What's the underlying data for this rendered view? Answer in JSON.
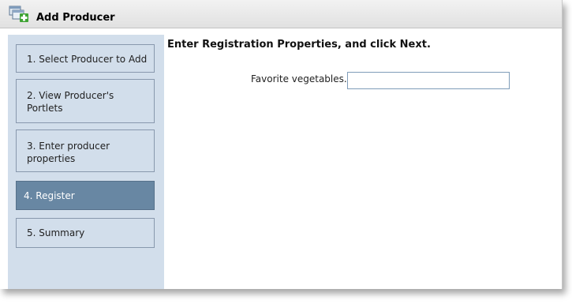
{
  "window": {
    "title": "Add Producer",
    "icon": "add-producer-icon"
  },
  "wizard": {
    "steps": [
      {
        "label": "1. Select Producer to Add",
        "active": false
      },
      {
        "label": "2. View Producer's Portlets",
        "active": false
      },
      {
        "label": "3. Enter producer properties",
        "active": false
      },
      {
        "label": "4. Register",
        "active": true
      },
      {
        "label": "5. Summary",
        "active": false
      }
    ]
  },
  "main": {
    "instructions": "Enter Registration Properties, and click Next.",
    "fields": [
      {
        "label": "Favorite vegetables.",
        "value": "",
        "placeholder": ""
      }
    ]
  },
  "colors": {
    "nav_background": "#d2deeb",
    "active_step": "#6887a3",
    "step_border": "#8898ad",
    "input_border": "#7f9db9"
  }
}
